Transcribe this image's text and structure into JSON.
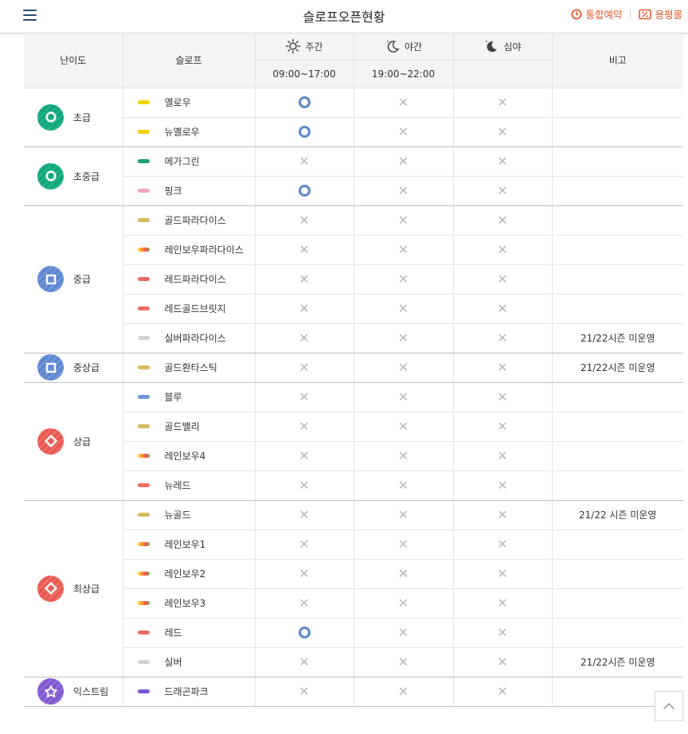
{
  "header": {
    "title": "슬로프오픈현황",
    "links": [
      {
        "label": "통합예약",
        "icon": "clock-icon"
      },
      {
        "label": "용평몰",
        "icon": "coupon-icon"
      }
    ]
  },
  "table": {
    "columns": {
      "level": "난이도",
      "slope": "슬로프",
      "day": "주간",
      "day_time": "09:00~17:00",
      "night": "야간",
      "night_time": "19:00~22:00",
      "late": "심야",
      "late_time": "",
      "note": "비고"
    },
    "groups": [
      {
        "level": "초급",
        "color": "#1fb28a",
        "shape": "circle",
        "slopes": [
          {
            "name": "옐로우",
            "pill": "#f2d000",
            "day": "open",
            "night": "closed",
            "late": "closed",
            "note": ""
          },
          {
            "name": "뉴옐로우",
            "pill": "#f2d000",
            "day": "open",
            "night": "closed",
            "late": "closed",
            "note": ""
          }
        ]
      },
      {
        "level": "초중급",
        "color": "#1fb28a",
        "shape": "circle",
        "slopes": [
          {
            "name": "메가그린",
            "pill": "#1f9e78",
            "day": "closed",
            "night": "closed",
            "late": "closed",
            "note": ""
          },
          {
            "name": "핑크",
            "pill": "#f5a3c4",
            "day": "open",
            "night": "closed",
            "late": "closed",
            "note": ""
          }
        ]
      },
      {
        "level": "중급",
        "color": "#6f95d8",
        "shape": "square",
        "slopes": [
          {
            "name": "골드파라다이스",
            "pill": "#d9bb5e",
            "day": "closed",
            "night": "closed",
            "late": "closed",
            "note": ""
          },
          {
            "name": "레인보우파라다이스",
            "pill": "rainbow",
            "day": "closed",
            "night": "closed",
            "late": "closed",
            "note": ""
          },
          {
            "name": "레드파라다이스",
            "pill": "#ec6b5f",
            "day": "closed",
            "night": "closed",
            "late": "closed",
            "note": ""
          },
          {
            "name": "레드골드브릿지",
            "pill": "#ec6b5f",
            "day": "closed",
            "night": "closed",
            "late": "closed",
            "note": ""
          },
          {
            "name": "실버파라다이스",
            "pill": "#cfd4d8",
            "day": "closed",
            "night": "closed",
            "late": "closed",
            "note": "21/22시즌 미운영"
          }
        ]
      },
      {
        "level": "중상급",
        "color": "#6f95d8",
        "shape": "square",
        "slopes": [
          {
            "name": "골드환타스틱",
            "pill": "#d9bb5e",
            "day": "closed",
            "night": "closed",
            "late": "closed",
            "note": "21/22시즌 미운영"
          }
        ]
      },
      {
        "level": "상급",
        "color": "#ef6b61",
        "shape": "diamond",
        "slopes": [
          {
            "name": "블루",
            "pill": "#6f95d8",
            "day": "closed",
            "night": "closed",
            "late": "closed",
            "note": ""
          },
          {
            "name": "골드밸리",
            "pill": "#d9bb5e",
            "day": "closed",
            "night": "closed",
            "late": "closed",
            "note": ""
          },
          {
            "name": "레인보우4",
            "pill": "rainbow",
            "day": "closed",
            "night": "closed",
            "late": "closed",
            "note": ""
          },
          {
            "name": "뉴레드",
            "pill": "#ec6b5f",
            "day": "closed",
            "night": "closed",
            "late": "closed",
            "note": ""
          }
        ]
      },
      {
        "level": "최상급",
        "color": "#ef6b61",
        "shape": "diamond",
        "slopes": [
          {
            "name": "뉴골드",
            "pill": "#d9bb5e",
            "day": "closed",
            "night": "closed",
            "late": "closed",
            "note": "21/22 시즌 미운영"
          },
          {
            "name": "레인보우1",
            "pill": "rainbow",
            "day": "closed",
            "night": "closed",
            "late": "closed",
            "note": ""
          },
          {
            "name": "레인보우2",
            "pill": "rainbow",
            "day": "closed",
            "night": "closed",
            "late": "closed",
            "note": ""
          },
          {
            "name": "레인보우3",
            "pill": "rainbow",
            "day": "closed",
            "night": "closed",
            "late": "closed",
            "note": ""
          },
          {
            "name": "레드",
            "pill": "#ec6b5f",
            "day": "open",
            "night": "closed",
            "late": "closed",
            "note": ""
          },
          {
            "name": "실버",
            "pill": "#cfd4d8",
            "day": "closed",
            "night": "closed",
            "late": "closed",
            "note": "21/22시즌 미운영"
          }
        ]
      },
      {
        "level": "익스트림",
        "color": "#8e6ad8",
        "shape": "star",
        "slopes": [
          {
            "name": "드래곤파크",
            "pill": "#7a55d6",
            "day": "closed",
            "night": "closed",
            "late": "closed",
            "note": ""
          }
        ]
      }
    ]
  },
  "icons": {
    "menu": "hamburger-menu-icon",
    "day": "sun-icon",
    "night": "moon-icon",
    "late": "moon-icon",
    "open": "open-circle-icon",
    "closed": "closed-x-icon",
    "top": "chevron-up-icon"
  }
}
